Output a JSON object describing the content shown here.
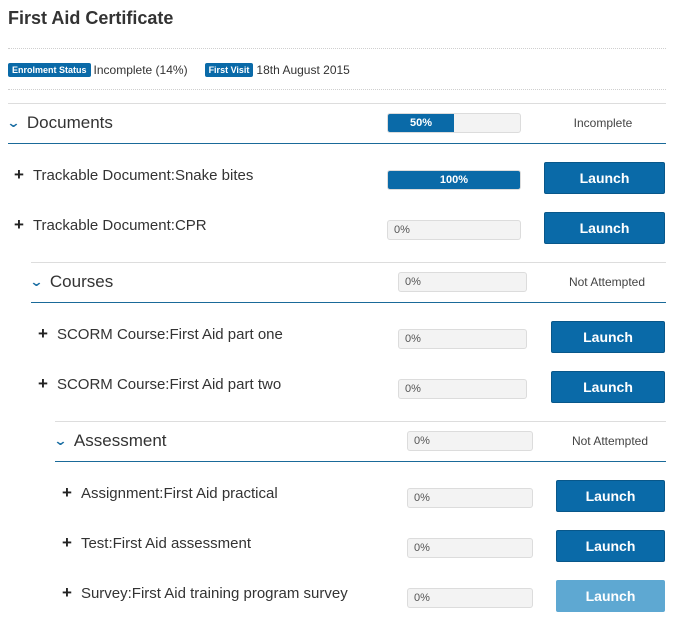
{
  "page_title": "First Aid Certificate",
  "meta": {
    "enrolment_label": "Enrolment Status",
    "enrolment_value": "Incomplete (14%)",
    "first_visit_label": "First Visit",
    "first_visit_value": "18th August 2015"
  },
  "colors": {
    "accent": "#0a6aa8",
    "disabled": "#5ea8d2"
  },
  "sections": {
    "documents": {
      "title": "Documents",
      "progress_label": "50%",
      "progress": 50,
      "status": "Incomplete"
    },
    "courses": {
      "title": "Courses",
      "progress_label": "0%",
      "progress": 0,
      "status": "Not Attempted"
    },
    "assessment": {
      "title": "Assessment",
      "progress_label": "0%",
      "progress": 0,
      "status": "Not Attempted"
    }
  },
  "items": [
    {
      "label": "Trackable Document:Snake bites",
      "progress_label": "100%",
      "progress": 100,
      "launch": "Launch"
    },
    {
      "label": "Trackable Document:CPR",
      "progress_label": "0%",
      "progress": 0,
      "launch": "Launch"
    },
    {
      "label": "SCORM Course:First Aid part one",
      "progress_label": "0%",
      "progress": 0,
      "launch": "Launch"
    },
    {
      "label": "SCORM Course:First Aid part two",
      "progress_label": "0%",
      "progress": 0,
      "launch": "Launch"
    },
    {
      "label": "Assignment:First Aid practical",
      "progress_label": "0%",
      "progress": 0,
      "launch": "Launch"
    },
    {
      "label": "Test:First Aid assessment",
      "progress_label": "0%",
      "progress": 0,
      "launch": "Launch"
    },
    {
      "label": "Survey:First Aid training program survey",
      "progress_label": "0%",
      "progress": 0,
      "launch": "Launch",
      "disabled": true
    }
  ]
}
